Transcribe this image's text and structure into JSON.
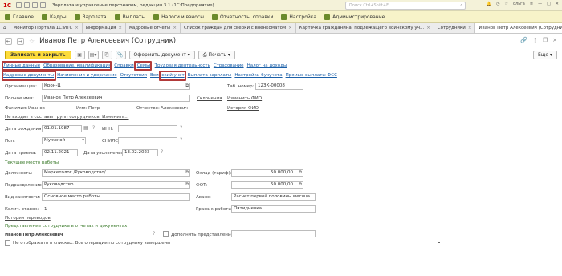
{
  "titlebar": {
    "logo": "1С",
    "title": "Зарплата и управление персоналом, редакция 3.1  (1С:Предприятие)",
    "search_placeholder": "Поиск Ctrl+Shift+F",
    "user": "ольга"
  },
  "sections": [
    "Главное",
    "Кадры",
    "Зарплата",
    "Выплаты",
    "Налоги и взносы",
    "Отчетность, справки",
    "Настройка",
    "Администрирование"
  ],
  "tabs": [
    "Монитор Портала 1С:ИТС",
    "Информация",
    "Кадровые отчеты",
    "Список граждан для сверки с военкоматом",
    "Карточка гражданина, подлежащего воинскому уч...",
    "Сотрудники",
    "Иванов Петр Алексеевич (Сотрудник)"
  ],
  "header": {
    "title": "Иванов Петр Алексеевич (Сотрудник)"
  },
  "toolbar": {
    "save_close": "Записать и закрыть",
    "format_doc": "Оформить документ",
    "print": "Печать",
    "more": "Еще",
    "help": "?"
  },
  "links_row1": [
    "Личные данные",
    "Образование, квалификация",
    "Справки",
    "Семья",
    "Трудовая деятельность",
    "Страхование",
    "Налог на доходы"
  ],
  "links_row2": [
    "Кадровые документы",
    "Начисления и удержания",
    "Отсутствия",
    "Воинский учет",
    "Выплата зарплаты",
    "Настройки бухучета",
    "Прямые выплаты ФСС"
  ],
  "form": {
    "org_label": "Организация:",
    "org_value": "Крон-Ц",
    "tab_num_label": "Таб. номер:",
    "tab_num_value": "12ЗК-00008",
    "fullname_label": "Полное имя:",
    "fullname_value": "Иванов Петр Алексеевич",
    "declension_link": "Склонения",
    "change_fio_link": "Изменить ФИО",
    "surname_label": "Фамилия:",
    "surname_value": "Иванов",
    "name_label": "Имя:",
    "name_value": "Петр",
    "patronymic_label": "Отчество:",
    "patronymic_value": "Алексеевич",
    "history_fio_link": "История ФИО",
    "groups_link": "Не входит в составы групп сотрудников. Изменить...",
    "birth_label": "Дата рождения:",
    "birth_value": "01.01.1987",
    "inn_label": "ИНН:",
    "gender_label": "Пол:",
    "gender_value": "Мужской",
    "snils_label": "СНИЛС:",
    "snils_value": "-   -",
    "hire_label": "Дата приема:",
    "hire_value": "02.11.2021",
    "dismissal_label": "Дата увольнения:",
    "dismissal_value": "13.02.2023",
    "workplace_section": "Текущее место работы",
    "position_label": "Должность:",
    "position_value": "Маркетолог /Руководство/",
    "salary_label": "Оклад (тариф):",
    "salary_value": "50 000,00",
    "department_label": "Подразделение:",
    "department_value": "Руководство",
    "fot_label": "ФОТ:",
    "fot_value": "50 000,00",
    "employment_label": "Вид занятости:",
    "employment_value": "Основное место работы",
    "advance_label": "Аванс:",
    "advance_value": "Расчет первой половины месяца",
    "rates_label": "Колич. ставок:",
    "rates_value": "1",
    "schedule_label": "График работы:",
    "schedule_value": "Пятидневка",
    "transfers_link": "История переводов",
    "representation_section": "Представление сотрудника в отчетах и документах",
    "representation_name": "Иванов Петр Алексеевич",
    "clarify_label": "Дополнять представление",
    "hide_label": "Не отображать в списках. Все операции по сотруднику завершены",
    "q": "?"
  },
  "colors": {
    "accent_yellow": "#fddc3b",
    "highlight_red": "#b23a3a",
    "link_blue": "#1a5fa8",
    "section_green": "#3a7a2a"
  }
}
